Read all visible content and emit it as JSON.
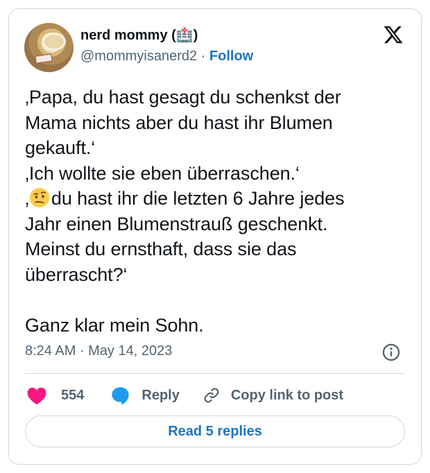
{
  "author": {
    "display_name": "nerd mommy (🏥)",
    "handle": "@mommyisanerd2",
    "separator": "·",
    "follow_label": "Follow"
  },
  "tweet": {
    "lines": [
      "‚Papa, du hast gesagt du schenkst der",
      "Mama nichts aber du hast ihr Blumen",
      "gekauft.‘",
      "‚Ich wollte sie eben überraschen.‘",
      "‚",
      "du hast ihr die letzten 6 Jahre jedes",
      "Jahr einen Blumenstrauß geschenkt.",
      "Meinst du ernsthaft, dass sie das",
      "überrascht?‘",
      "Ganz klar mein Sohn."
    ],
    "emoji_icon": "face-with-raised-eyebrow-icon"
  },
  "meta": {
    "timestamp": "8:24 AM · May 14, 2023"
  },
  "actions": {
    "like_count": "554",
    "reply_label": "Reply",
    "copy_label": "Copy link to post"
  },
  "footer": {
    "read_replies_label": "Read 5 replies"
  },
  "colors": {
    "heart": "#f91880",
    "reply_bubble": "#1d9bf0",
    "link": "#1d74c4",
    "secondary_text": "#536471",
    "border": "#cfd9de"
  }
}
